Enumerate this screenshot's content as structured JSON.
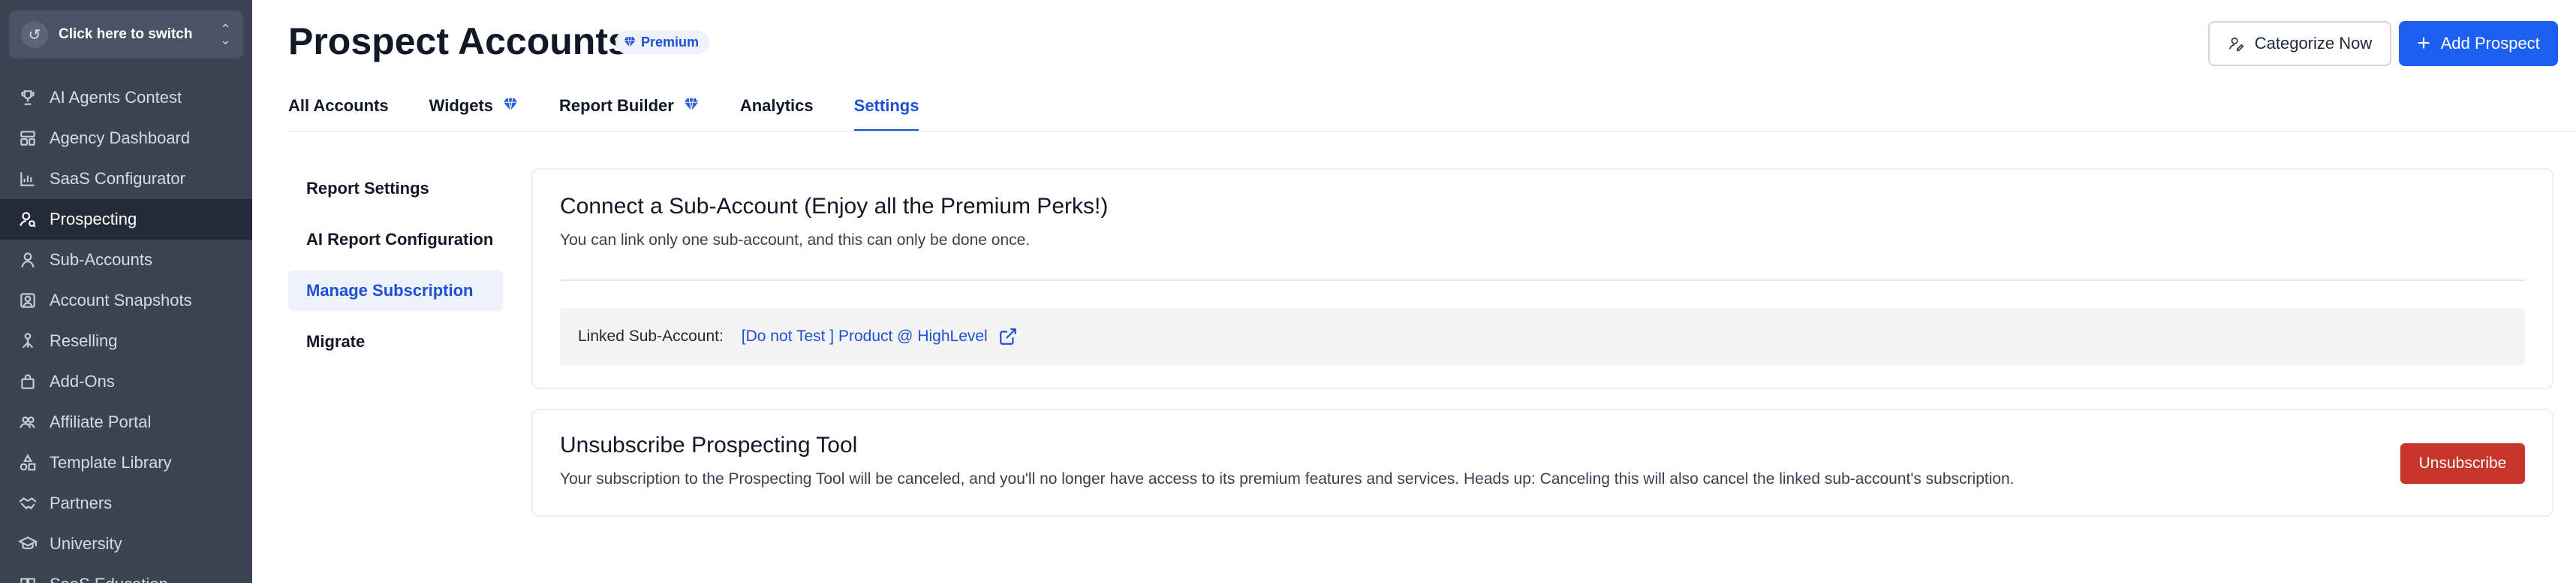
{
  "sidebar": {
    "switcher_label": "Click here to switch",
    "switcher_icon": "switch-location-icon",
    "items": [
      {
        "label": "AI Agents Contest",
        "icon": "trophy-icon",
        "active": false
      },
      {
        "label": "Agency Dashboard",
        "icon": "dashboard-icon",
        "active": false
      },
      {
        "label": "SaaS Configurator",
        "icon": "bar-chart-icon",
        "active": false
      },
      {
        "label": "Prospecting",
        "icon": "user-search-icon",
        "active": true
      },
      {
        "label": "Sub-Accounts",
        "icon": "user-icon",
        "active": false
      },
      {
        "label": "Account Snapshots",
        "icon": "snapshot-icon",
        "active": false
      },
      {
        "label": "Reselling",
        "icon": "reselling-icon",
        "active": false
      },
      {
        "label": "Add-Ons",
        "icon": "bag-icon",
        "active": false
      },
      {
        "label": "Affiliate Portal",
        "icon": "users-icon",
        "active": false
      },
      {
        "label": "Template Library",
        "icon": "shapes-icon",
        "active": false
      },
      {
        "label": "Partners",
        "icon": "handshake-icon",
        "active": false
      },
      {
        "label": "University",
        "icon": "graduation-cap-icon",
        "active": false
      },
      {
        "label": "SaaS Education",
        "icon": "book-icon",
        "active": false
      }
    ]
  },
  "header": {
    "title": "Prospect Accounts",
    "badge": "Premium",
    "categorize_label": "Categorize Now",
    "add_label": "Add Prospect"
  },
  "tabs": [
    {
      "label": "All Accounts",
      "premium": false,
      "active": false
    },
    {
      "label": "Widgets",
      "premium": true,
      "active": false
    },
    {
      "label": "Report Builder",
      "premium": true,
      "active": false
    },
    {
      "label": "Analytics",
      "premium": false,
      "active": false
    },
    {
      "label": "Settings",
      "premium": false,
      "active": true
    }
  ],
  "subnav": [
    {
      "label": "Report Settings",
      "active": false
    },
    {
      "label": "AI Report Configuration",
      "active": false
    },
    {
      "label": "Manage Subscription",
      "active": true
    },
    {
      "label": "Migrate",
      "active": false
    }
  ],
  "connect_card": {
    "title": "Connect a Sub-Account (Enjoy all the Premium Perks!)",
    "description": "You can link only one sub-account, and this can only be done once.",
    "linked_label": "Linked Sub-Account:",
    "linked_value": "[Do not Test ] Product @ HighLevel"
  },
  "unsubscribe_card": {
    "title": "Unsubscribe Prospecting Tool",
    "description": "Your subscription to the Prospecting Tool will be canceled, and you'll no longer have access to its premium features and services. Heads up: Canceling this will also cancel the linked sub-account's subscription.",
    "button_label": "Unsubscribe"
  },
  "colors": {
    "sidebar_bg": "#3b4453",
    "sidebar_active": "#232b38",
    "accent": "#1d5ff0",
    "danger": "#c6352a"
  }
}
